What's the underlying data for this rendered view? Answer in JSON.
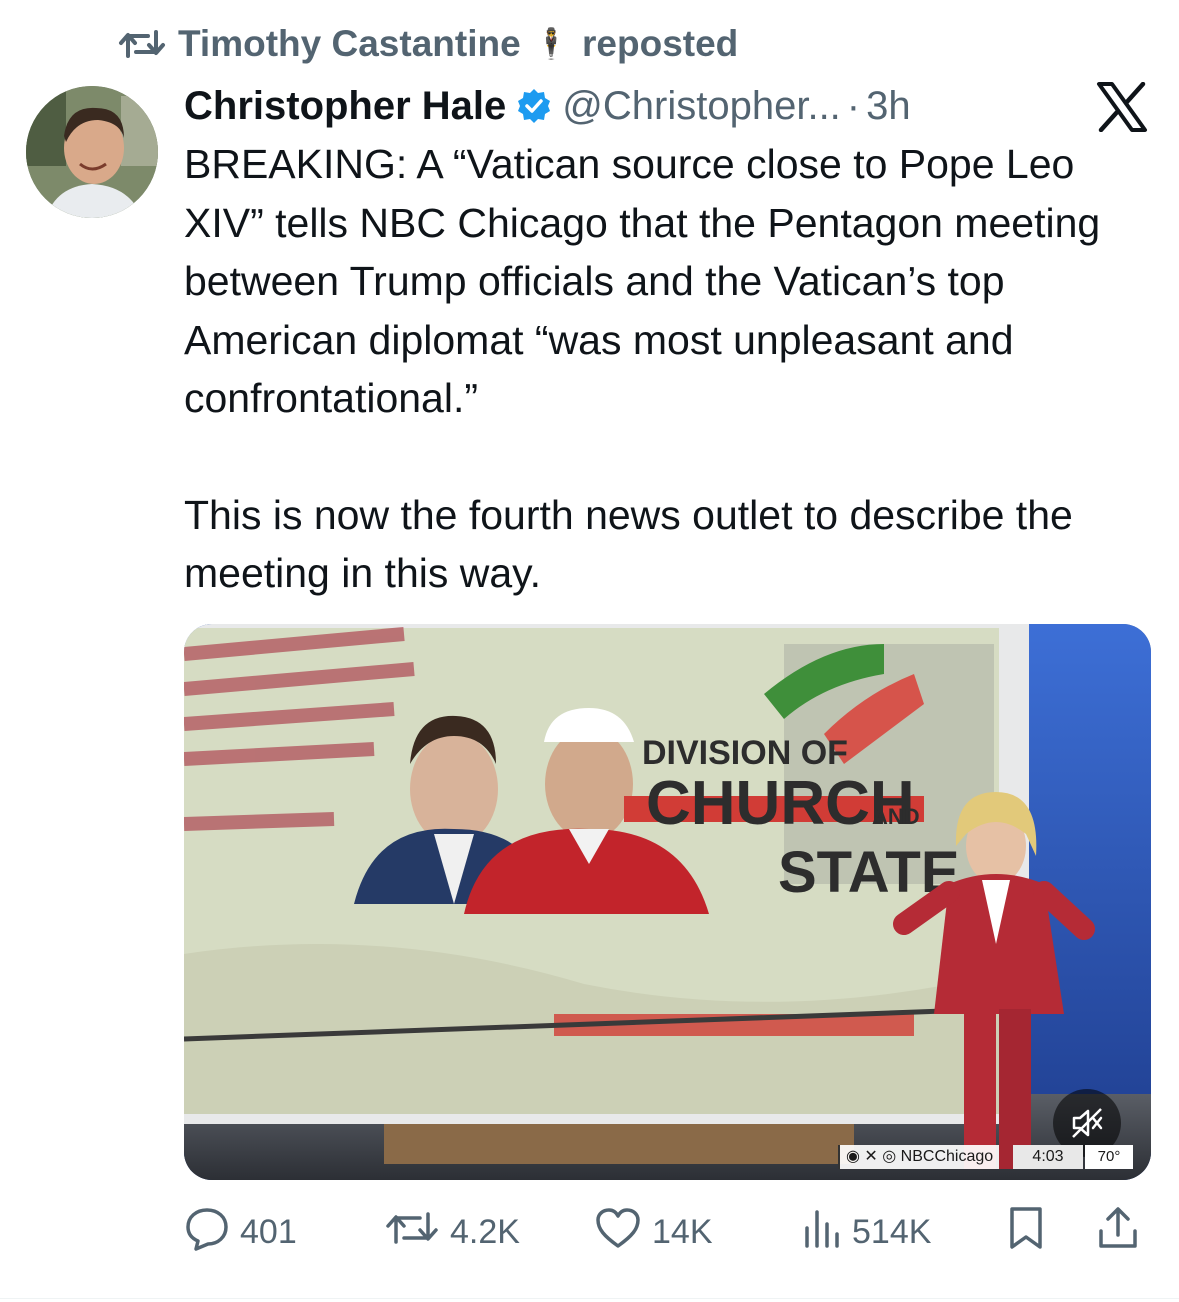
{
  "repost": {
    "user_name": "Timothy Castantine",
    "emoji": "🕴",
    "action_label": "reposted",
    "icon": "repost-icon"
  },
  "tweet": {
    "author_name": "Christopher Hale",
    "verified": true,
    "handle": "@Christopher...",
    "separator": "·",
    "time": "3h",
    "paragraphs": [
      "BREAKING: A “Vatican source close to Pope Leo XIV” tells NBC Chicago that the Pentagon meeting between Trump officials and the Vatican’s top American diplomat “was most unpleasant and confrontational.”",
      "This is now the fourth news outlet to describe the meeting in this way."
    ]
  },
  "media": {
    "headline_line1": "DIVISION OF",
    "headline_line2": "CHURCH",
    "headline_and": "AND",
    "headline_line3": "STATE",
    "source_handle": "NBCChicago",
    "clock": "4:03",
    "temperature": "70°",
    "mute_icon": "speaker-muted-icon"
  },
  "actions": {
    "replies": "401",
    "reposts": "4.2K",
    "likes": "14K",
    "views": "514K"
  },
  "colors": {
    "text_primary": "#0f1419",
    "text_secondary": "#536471",
    "verified_blue": "#1d9bf0"
  }
}
